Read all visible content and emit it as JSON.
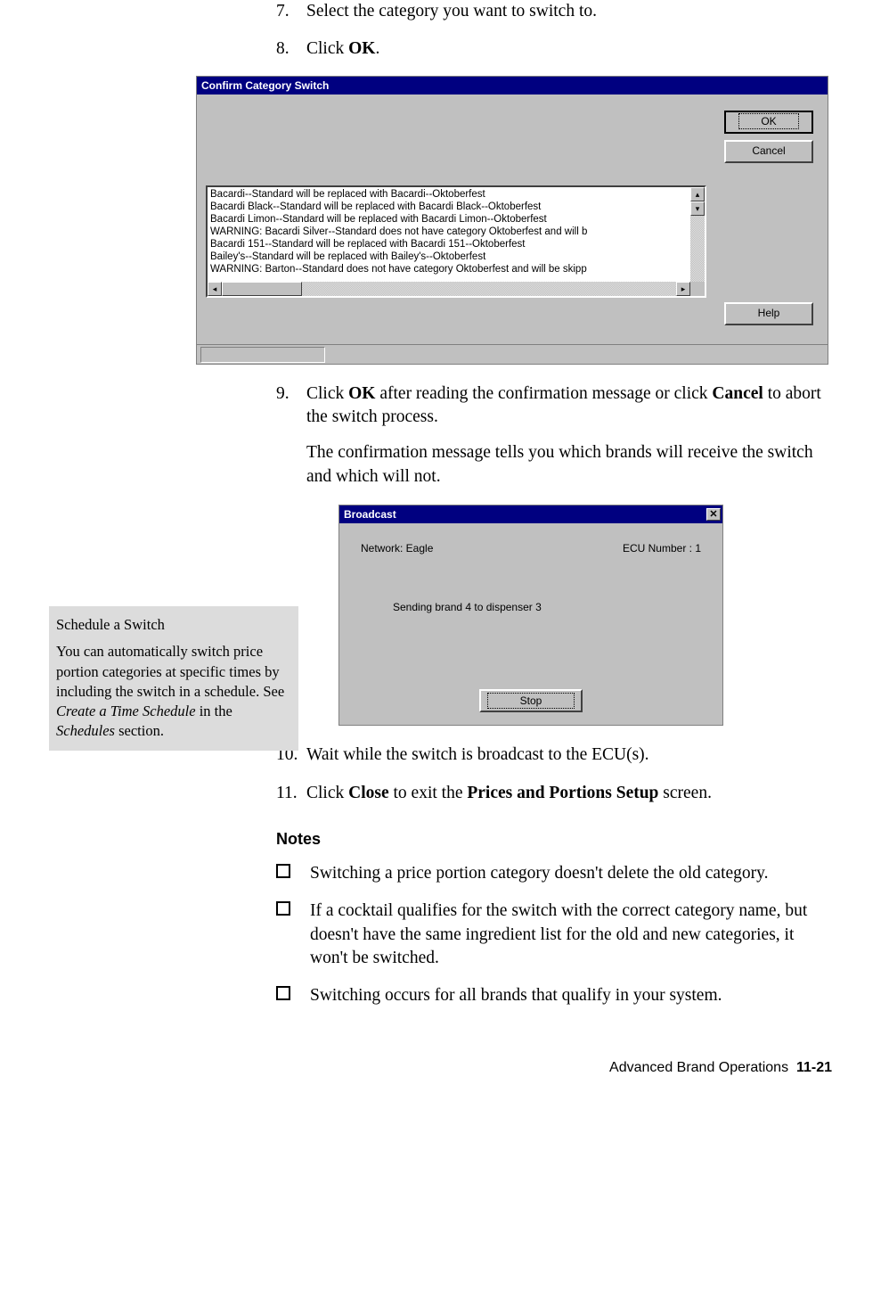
{
  "steps": {
    "s7": {
      "num": "7.",
      "text": "Select the category you want to switch to."
    },
    "s8": {
      "num": "8.",
      "text_pre": "Click ",
      "bold": "OK",
      "text_post": "."
    },
    "s9": {
      "num": "9.",
      "part1_pre": "Click ",
      "bold1": "OK",
      "part1_mid": " after reading the confirmation message or click ",
      "bold2": "Cancel",
      "part1_post": " to abort the switch process.",
      "para2": "The confirmation message tells you which brands will receive the switch and which will not."
    },
    "s10": {
      "num": "10.",
      "text": "Wait while the switch is broadcast to the ECU(s)."
    },
    "s11": {
      "num": "11.",
      "pre": "Click ",
      "b1": "Close",
      "mid": " to exit the ",
      "b2": "Prices and Portions Setup",
      "post": " screen."
    }
  },
  "dialog1": {
    "title": "Confirm Category Switch",
    "ok": "OK",
    "cancel": "Cancel",
    "help": "Help",
    "lines": [
      "Bacardi--Standard will be replaced with Bacardi--Oktoberfest",
      "Bacardi Black--Standard will be replaced with Bacardi Black--Oktoberfest",
      "Bacardi Limon--Standard will be replaced with Bacardi Limon--Oktoberfest",
      "WARNING: Bacardi Silver--Standard does not have category Oktoberfest and will b",
      "Bacardi 151--Standard will be replaced with Bacardi 151--Oktoberfest",
      "Bailey's--Standard will be replaced with Bailey's--Oktoberfest",
      "WARNING: Barton--Standard does not have category Oktoberfest and will be skipp"
    ]
  },
  "dialog2": {
    "title": "Broadcast",
    "network_label": "Network: Eagle",
    "ecu_label": "ECU Number : 1",
    "message": "Sending brand 4 to dispenser 3",
    "stop": "Stop",
    "close_x": "✕"
  },
  "sidebar": {
    "title": "Schedule a Switch",
    "body_pre": "You can automatically switch price portion categories at specific times by including the switch in a schedule. ",
    "see": "See ",
    "ital1": "Create a Time Schedule",
    "mid": " in the ",
    "ital2": "Schedules",
    "post": " section."
  },
  "notes": {
    "heading": "Notes",
    "items": [
      "Switching a price portion category doesn't delete the old category.",
      "If a cocktail qualifies for the switch with the correct category name, but doesn't have the same ingredient list for the old and new categories, it won't be switched.",
      "Switching occurs for all brands that qualify in your system."
    ]
  },
  "footer": {
    "section": "Advanced Brand Operations",
    "page": "11-21"
  }
}
